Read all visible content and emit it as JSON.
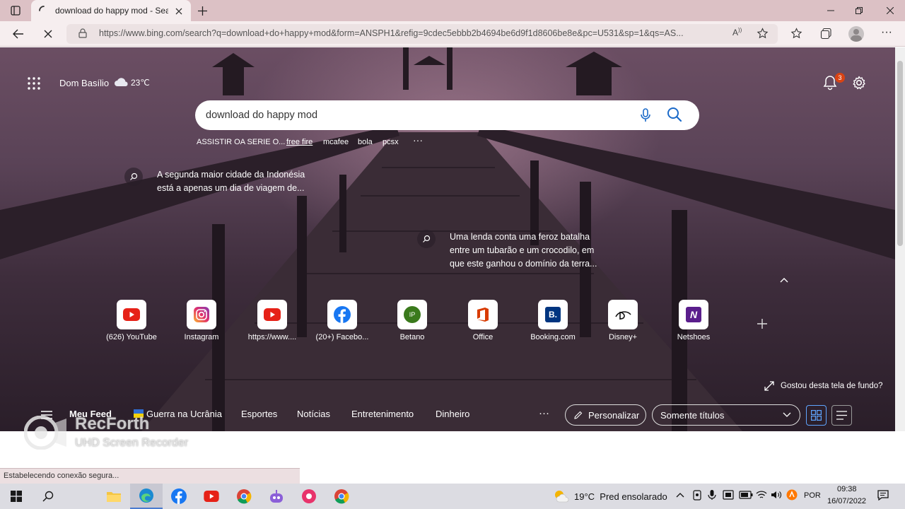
{
  "browser": {
    "tab_title": "download do happy mod - Sear",
    "url": "https://www.bing.com/search?q=download+do+happy+mod&form=ANSPH1&refig=9cdec5ebbb2b4694be6d9f1d8606be8e&pc=U531&sp=1&qs=AS..."
  },
  "header": {
    "location": "Dom Basílio",
    "temperature": "23℃",
    "notification_count": "3"
  },
  "search": {
    "query": "download do happy mod",
    "suggestions": [
      "ASSISTIR OA SERIE O...",
      "free fire",
      "mcafee",
      "bola",
      "pcsx"
    ],
    "more": "···"
  },
  "qtips": [
    {
      "line1": "A segunda maior cidade da Indonésia",
      "line2": "está a apenas um dia de viagem de..."
    },
    {
      "line1": "Uma lenda conta uma feroz batalha",
      "line2": "entre um tubarão e um crocodilo, em",
      "line3": "que este ganhou o domínio da terra..."
    }
  ],
  "tiles": [
    {
      "label": "(626) YouTube",
      "icon": "youtube-icon",
      "color": "#e62117"
    },
    {
      "label": "Instagram",
      "icon": "instagram-icon",
      "color": "#d6249f"
    },
    {
      "label": "https://www....",
      "icon": "youtube-icon",
      "color": "#e62117"
    },
    {
      "label": "(20+) Facebo...",
      "icon": "facebook-icon",
      "color": "#1877f2"
    },
    {
      "label": "Betano",
      "icon": "betano-icon",
      "color": "#3a7a1c",
      "glyph": "IP"
    },
    {
      "label": "Office",
      "icon": "office-icon",
      "color": "#d83b01"
    },
    {
      "label": "Booking.com",
      "icon": "booking-icon",
      "color": "#003580",
      "glyph": "B."
    },
    {
      "label": "Disney+",
      "icon": "disney-icon",
      "color": "#111111"
    },
    {
      "label": "Netshoes",
      "icon": "netshoes-icon",
      "color": "#5a1e8c",
      "glyph": "N"
    }
  ],
  "background_credit": "Gostou desta tela de fundo?",
  "feed": {
    "items": [
      "Meu Feed",
      "Guerra na Ucrânia",
      "Esportes",
      "Notícias",
      "Entretenimento",
      "Dinheiro"
    ],
    "more": "···",
    "personalize": "Personalizar",
    "view_select": "Somente títulos"
  },
  "watermark": {
    "title": "RecForth",
    "subtitle": "UHD Screen Recorder"
  },
  "status_text": "Estabelecendo conexão segura...",
  "taskbar": {
    "weather": "19°C  Pred ensolarado",
    "language": "POR",
    "time": "09:38",
    "date": "16/07/2022"
  }
}
